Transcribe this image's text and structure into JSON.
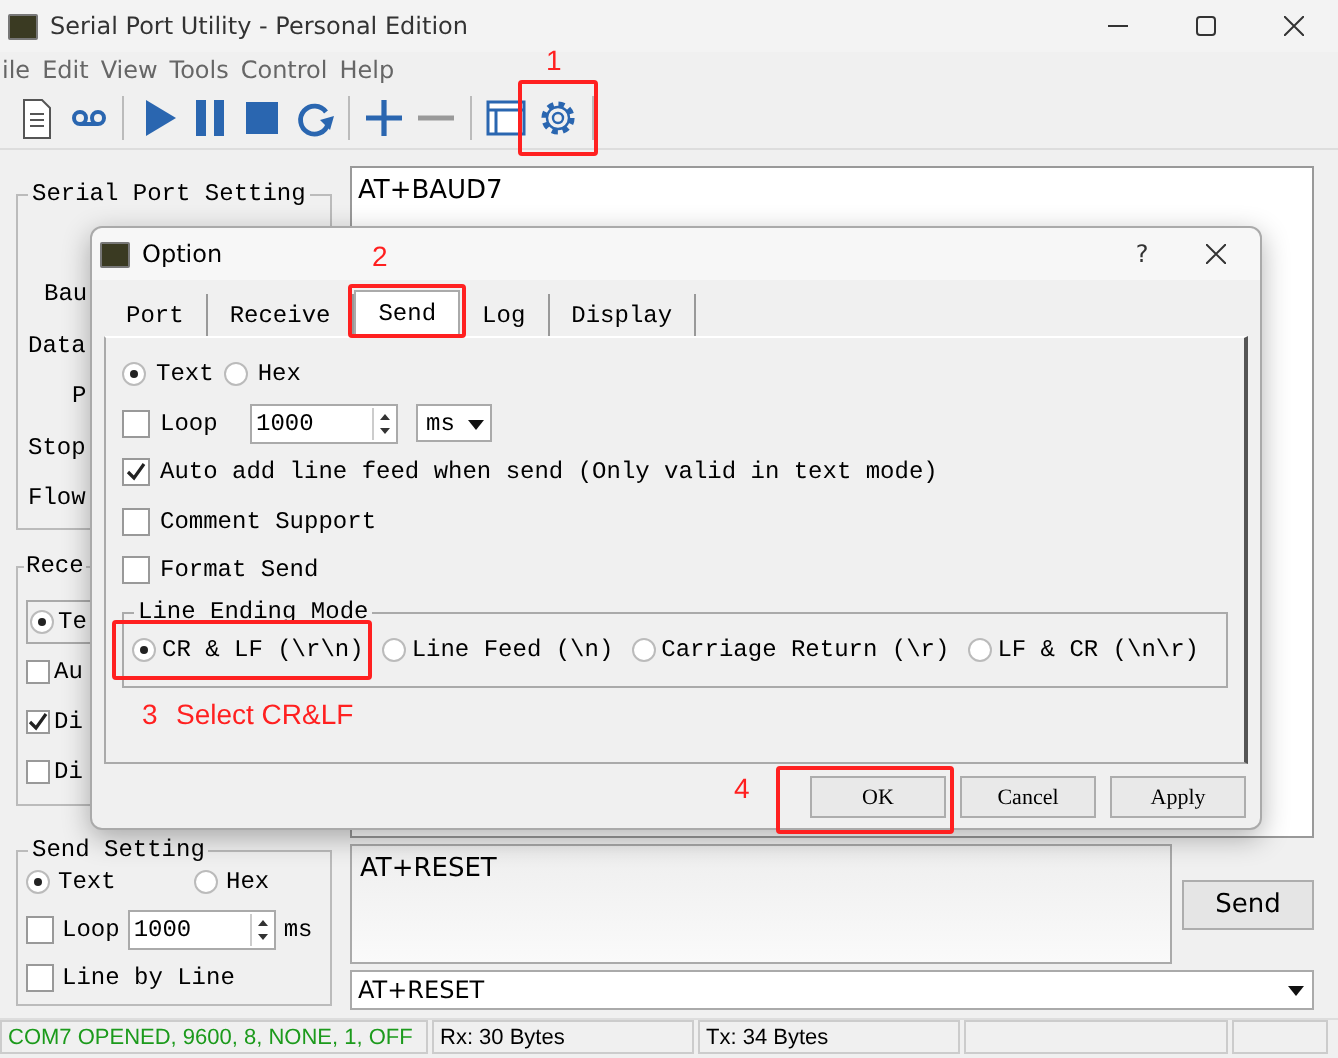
{
  "window": {
    "title": "Serial Port Utility - Personal Edition"
  },
  "menu": [
    "ile",
    "Edit",
    "View",
    "Tools",
    "Control",
    "Help"
  ],
  "serial_port_setting": {
    "title": "Serial Port Setting",
    "labels": [
      "Bau",
      "Data",
      "P",
      "Stop",
      "Flow"
    ]
  },
  "receive_setting": {
    "title": "Rece",
    "items": [
      {
        "kind": "radio",
        "label": "Te",
        "checked": true
      },
      {
        "kind": "checkbox",
        "label": "Au",
        "checked": false
      },
      {
        "kind": "checkbox",
        "label": "Di",
        "checked": true
      },
      {
        "kind": "checkbox",
        "label": "Di",
        "checked": false
      }
    ]
  },
  "send_setting": {
    "title": "Send Setting",
    "format": [
      {
        "label": "Text",
        "selected": true
      },
      {
        "label": "Hex",
        "selected": false
      }
    ],
    "loop": {
      "label": "Loop",
      "checked": false,
      "value": "1000",
      "unit": "ms"
    },
    "line_by_line": {
      "label": "Line by Line",
      "checked": false
    }
  },
  "receive_area": {
    "text": "AT+BAUD7"
  },
  "send_area": {
    "text": "AT+RESET"
  },
  "send_button": "Send",
  "history": {
    "value": "AT+RESET"
  },
  "status_bar": [
    {
      "text": "COM7 OPENED, 9600, 8, NONE, 1, OFF",
      "color": "#1c9a1c"
    },
    {
      "text": "Rx: 30 Bytes",
      "color": "#000000"
    },
    {
      "text": "Tx: 34 Bytes",
      "color": "#000000"
    }
  ],
  "dialog": {
    "title": "Option",
    "help": "?",
    "tabs": [
      {
        "label": "Port",
        "selected": false
      },
      {
        "label": "Receive",
        "selected": false
      },
      {
        "label": "Send",
        "selected": true
      },
      {
        "label": "Log",
        "selected": false
      },
      {
        "label": "Display",
        "selected": false
      }
    ],
    "format": [
      {
        "label": "Text",
        "selected": true
      },
      {
        "label": "Hex",
        "selected": false
      }
    ],
    "loop": {
      "label": "Loop",
      "checked": false,
      "value": "1000",
      "unit": "ms"
    },
    "options": [
      {
        "label": "Auto add line feed when send (Only valid in text mode)",
        "checked": true
      },
      {
        "label": "Comment Support",
        "checked": false
      },
      {
        "label": "Format Send",
        "checked": false
      }
    ],
    "line_ending": {
      "title": "Line Ending Mode",
      "options": [
        {
          "label": "CR & LF (\\r\\n)",
          "selected": true
        },
        {
          "label": "Line Feed (\\n)",
          "selected": false
        },
        {
          "label": "Carriage Return (\\r)",
          "selected": false
        },
        {
          "label": "LF & CR (\\n\\r)",
          "selected": false
        }
      ]
    },
    "buttons": [
      "OK",
      "Cancel",
      "Apply"
    ]
  },
  "annotations": [
    {
      "step": "1"
    },
    {
      "step": "2"
    },
    {
      "step": "3",
      "note": "Select CR&LF"
    },
    {
      "step": "4"
    }
  ]
}
